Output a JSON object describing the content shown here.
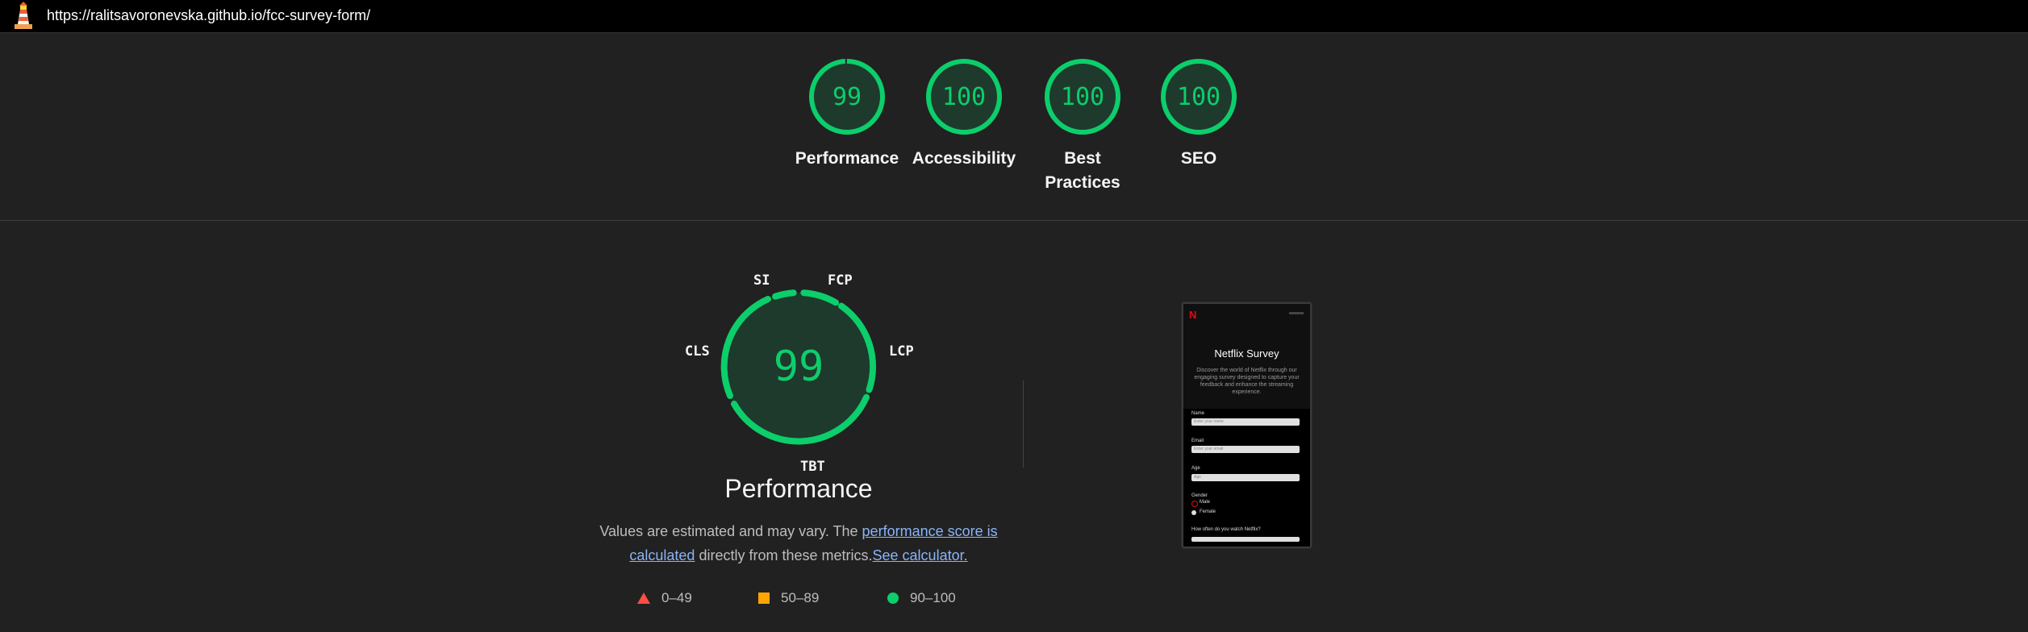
{
  "browser": {
    "url": "https://ralitsavoronevska.github.io/fcc-survey-form/"
  },
  "colors": {
    "pass": "#0cce6b",
    "average": "#ffa400",
    "fail": "#ff4e42",
    "background": "#212121"
  },
  "scores": [
    {
      "value": "99",
      "label": "Performance",
      "fraction": 0.99
    },
    {
      "value": "100",
      "label": "Accessibility",
      "fraction": 1.0
    },
    {
      "value": "100",
      "label": "Best Practices",
      "fraction": 1.0
    },
    {
      "value": "100",
      "label": "SEO",
      "fraction": 1.0
    }
  ],
  "performance": {
    "score": "99",
    "title": "Performance",
    "metrics": [
      "SI",
      "FCP",
      "LCP",
      "TBT",
      "CLS"
    ],
    "description": {
      "pre": "Values are estimated and may vary. The ",
      "link1": "performance score is calculated",
      "mid": " directly from these metrics.",
      "link2": "See calculator."
    },
    "legend": [
      {
        "shape": "triangle",
        "label": "0–49"
      },
      {
        "shape": "square",
        "label": "50–89"
      },
      {
        "shape": "circle",
        "label": "90–100"
      }
    ]
  },
  "thumbnail": {
    "logo": "N",
    "title": "Netflix Survey",
    "description": "Discover the world of Netflix through our engaging survey designed to capture your feedback and enhance the streaming experience.",
    "fields": [
      {
        "label": "Name",
        "placeholder": "Enter your name"
      },
      {
        "label": "Email",
        "placeholder": "Enter your email"
      },
      {
        "label": "Age",
        "placeholder": "Age"
      }
    ],
    "gender_label": "Gender",
    "gender_options": [
      "Male",
      "Female"
    ],
    "question": "How often do you watch Netflix?"
  }
}
